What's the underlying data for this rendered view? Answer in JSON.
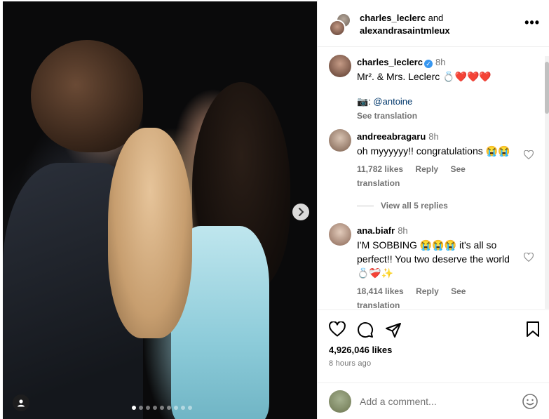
{
  "post": {
    "carousel": {
      "total": 9,
      "current": 1
    },
    "icons": {
      "next": "chevron-right-icon",
      "tag": "user-icon"
    }
  },
  "header": {
    "user1": "charles_leclerc",
    "joiner": "and",
    "user2": "alexandrasaintmleux",
    "more_icon": "more-horizontal-icon"
  },
  "caption": {
    "username": "charles_leclerc",
    "verified_icon": "verified-badge-icon",
    "time": "8h",
    "text": "Mr². & Mrs. Leclerc 💍❤️❤️❤️",
    "credit_prefix": "📷: ",
    "credit_link": "@antoine",
    "translation": "See translation"
  },
  "comments": [
    {
      "username": "andreeabragaru",
      "time": "8h",
      "text": "oh myyyyyy!! congratulations 😭😭",
      "likes": "11,782 likes",
      "reply": "Reply",
      "translation": "See translation",
      "view_replies": "View all 5 replies"
    },
    {
      "username": "ana.biafr",
      "time": "8h",
      "text": "I'M SOBBING 😭😭😭 it's all so perfect!! You two deserve the world 💍❤️‍🩹✨",
      "likes": "18,414 likes",
      "reply": "Reply",
      "translation": "See translation"
    }
  ],
  "actions": {
    "like_icon": "heart-icon",
    "comment_icon": "comment-icon",
    "share_icon": "send-icon",
    "save_icon": "bookmark-icon",
    "likes": "4,926,046 likes",
    "ago": "8 hours ago"
  },
  "add_comment": {
    "placeholder": "Add a comment...",
    "emoji_icon": "smiley-icon"
  },
  "colors": {
    "link": "#00376b",
    "secondary_text": "#737373",
    "verified": "#3897f0",
    "divider": "#efefef"
  }
}
